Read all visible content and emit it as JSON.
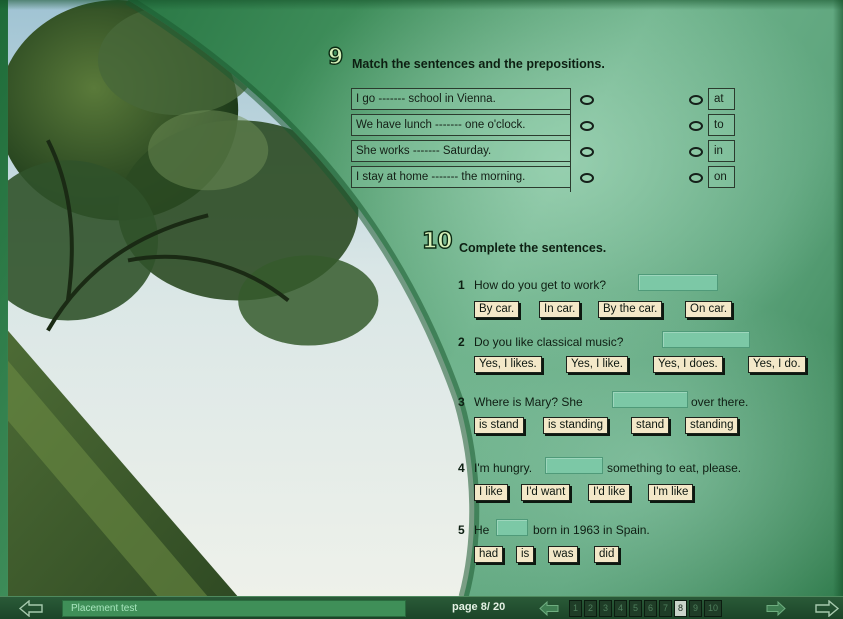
{
  "exercise9": {
    "number": "9",
    "title": "Match the sentences and the prepositions.",
    "sentences": [
      "I go ------- school in Vienna.",
      "We have lunch ------- one o'clock.",
      "She works ------- Saturday.",
      "I stay at home ------- the morning."
    ],
    "prepositions": [
      "at",
      "to",
      "in",
      "on"
    ]
  },
  "exercise10": {
    "number": "10",
    "title": "Complete the sentences.",
    "questions": [
      {
        "num": "1",
        "before": "How do you get to work?",
        "after": "",
        "options": [
          "By car.",
          "In car.",
          "By the car.",
          "On car."
        ]
      },
      {
        "num": "2",
        "before": "Do you like classical music?",
        "after": "",
        "options": [
          "Yes, I likes.",
          "Yes, I like.",
          "Yes, I does.",
          "Yes, I do."
        ]
      },
      {
        "num": "3",
        "before": "Where is Mary?  She",
        "after": "over there.",
        "options": [
          "is stand",
          "is standing",
          "stand",
          "standing"
        ]
      },
      {
        "num": "4",
        "before": "I'm hungry.",
        "after": "something to eat, please.",
        "options": [
          "I like",
          "I'd want",
          "I'd like",
          "I'm like"
        ]
      },
      {
        "num": "5",
        "before": "He",
        "after": "born in 1963 in Spain.",
        "options": [
          "had",
          "is",
          "was",
          "did"
        ]
      }
    ]
  },
  "bottombar": {
    "title": "Placement test",
    "page_indicator": "page 8/ 20",
    "pages": [
      "1",
      "2",
      "3",
      "4",
      "5",
      "6",
      "7",
      "8",
      "9",
      "10"
    ],
    "active_page": "8"
  },
  "icons": {
    "prev": "arrow-left-icon",
    "next": "arrow-right-icon",
    "page_prev": "small-arrow-left-icon",
    "page_next": "small-arrow-right-icon"
  }
}
